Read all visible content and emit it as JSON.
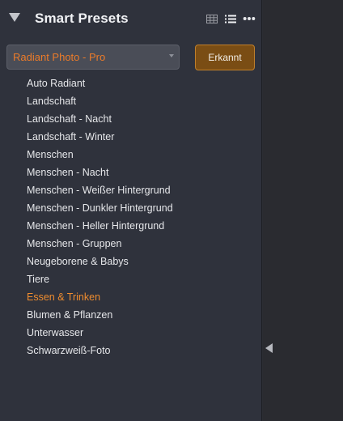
{
  "panel": {
    "title": "Smart Presets",
    "dropdown_value": "Radiant Photo - Pro",
    "detect_button_label": "Erkannt"
  },
  "presets": [
    {
      "label": "Auto Radiant",
      "active": false
    },
    {
      "label": "Landschaft",
      "active": false
    },
    {
      "label": "Landschaft - Nacht",
      "active": false
    },
    {
      "label": "Landschaft - Winter",
      "active": false
    },
    {
      "label": "Menschen",
      "active": false
    },
    {
      "label": "Menschen - Nacht",
      "active": false
    },
    {
      "label": "Menschen - Weißer Hintergrund",
      "active": false
    },
    {
      "label": "Menschen - Dunkler Hintergrund",
      "active": false
    },
    {
      "label": "Menschen - Heller Hintergrund",
      "active": false
    },
    {
      "label": "Menschen - Gruppen",
      "active": false
    },
    {
      "label": "Neugeborene & Babys",
      "active": false
    },
    {
      "label": "Tiere",
      "active": false
    },
    {
      "label": "Essen & Trinken",
      "active": true
    },
    {
      "label": "Blumen & Pflanzen",
      "active": false
    },
    {
      "label": "Unterwasser",
      "active": false
    },
    {
      "label": "Schwarzweiß-Foto",
      "active": false
    }
  ],
  "icons": {
    "collapse": "triangle-down-icon",
    "grid_view": "grid-view-icon",
    "list_view": "list-view-icon",
    "more": "more-dots-icon",
    "expand_side": "triangle-left-icon"
  },
  "colors": {
    "panel_bg": "#2f323c",
    "accent_orange": "#ec7b29",
    "button_bg": "#7a4d14",
    "button_border": "#c1802b"
  }
}
